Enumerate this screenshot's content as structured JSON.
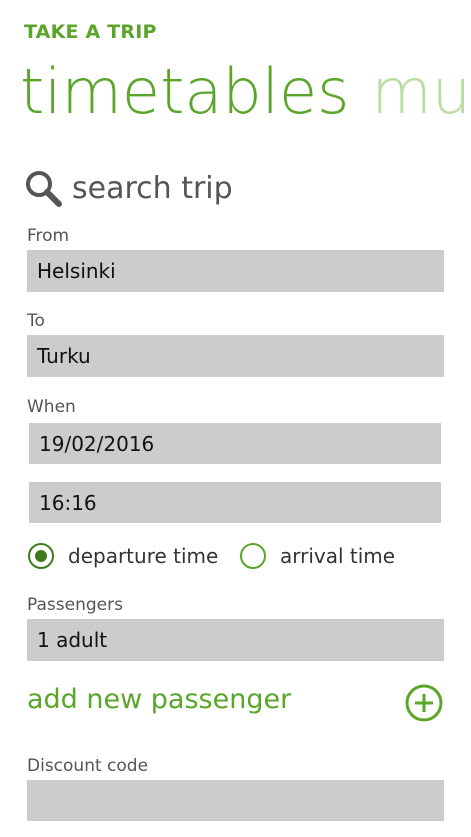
{
  "header": {
    "app_title": "TAKE A TRIP"
  },
  "pivot": {
    "tabs": [
      {
        "label": "timetables",
        "active": true
      },
      {
        "label": "mul",
        "active": false
      }
    ]
  },
  "search": {
    "icon": "search-icon",
    "label": "search trip"
  },
  "form": {
    "from": {
      "label": "From",
      "value": "Helsinki"
    },
    "to": {
      "label": "To",
      "value": "Turku"
    },
    "when": {
      "label": "When",
      "date": "19/02/2016",
      "time": "16:16"
    },
    "time_type": {
      "options": [
        {
          "label": "departure time",
          "selected": true
        },
        {
          "label": "arrival time",
          "selected": false
        }
      ]
    },
    "passengers": {
      "label": "Passengers",
      "value": "1 adult"
    },
    "add_passenger": {
      "label": "add new passenger",
      "icon": "plus-circle-icon"
    },
    "discount": {
      "label": "Discount code",
      "value": ""
    }
  },
  "colors": {
    "accent": "#5aa52a",
    "accent_light": "#b9dca1",
    "radio": "#3c7a1e",
    "field_bg": "#cccccc"
  }
}
